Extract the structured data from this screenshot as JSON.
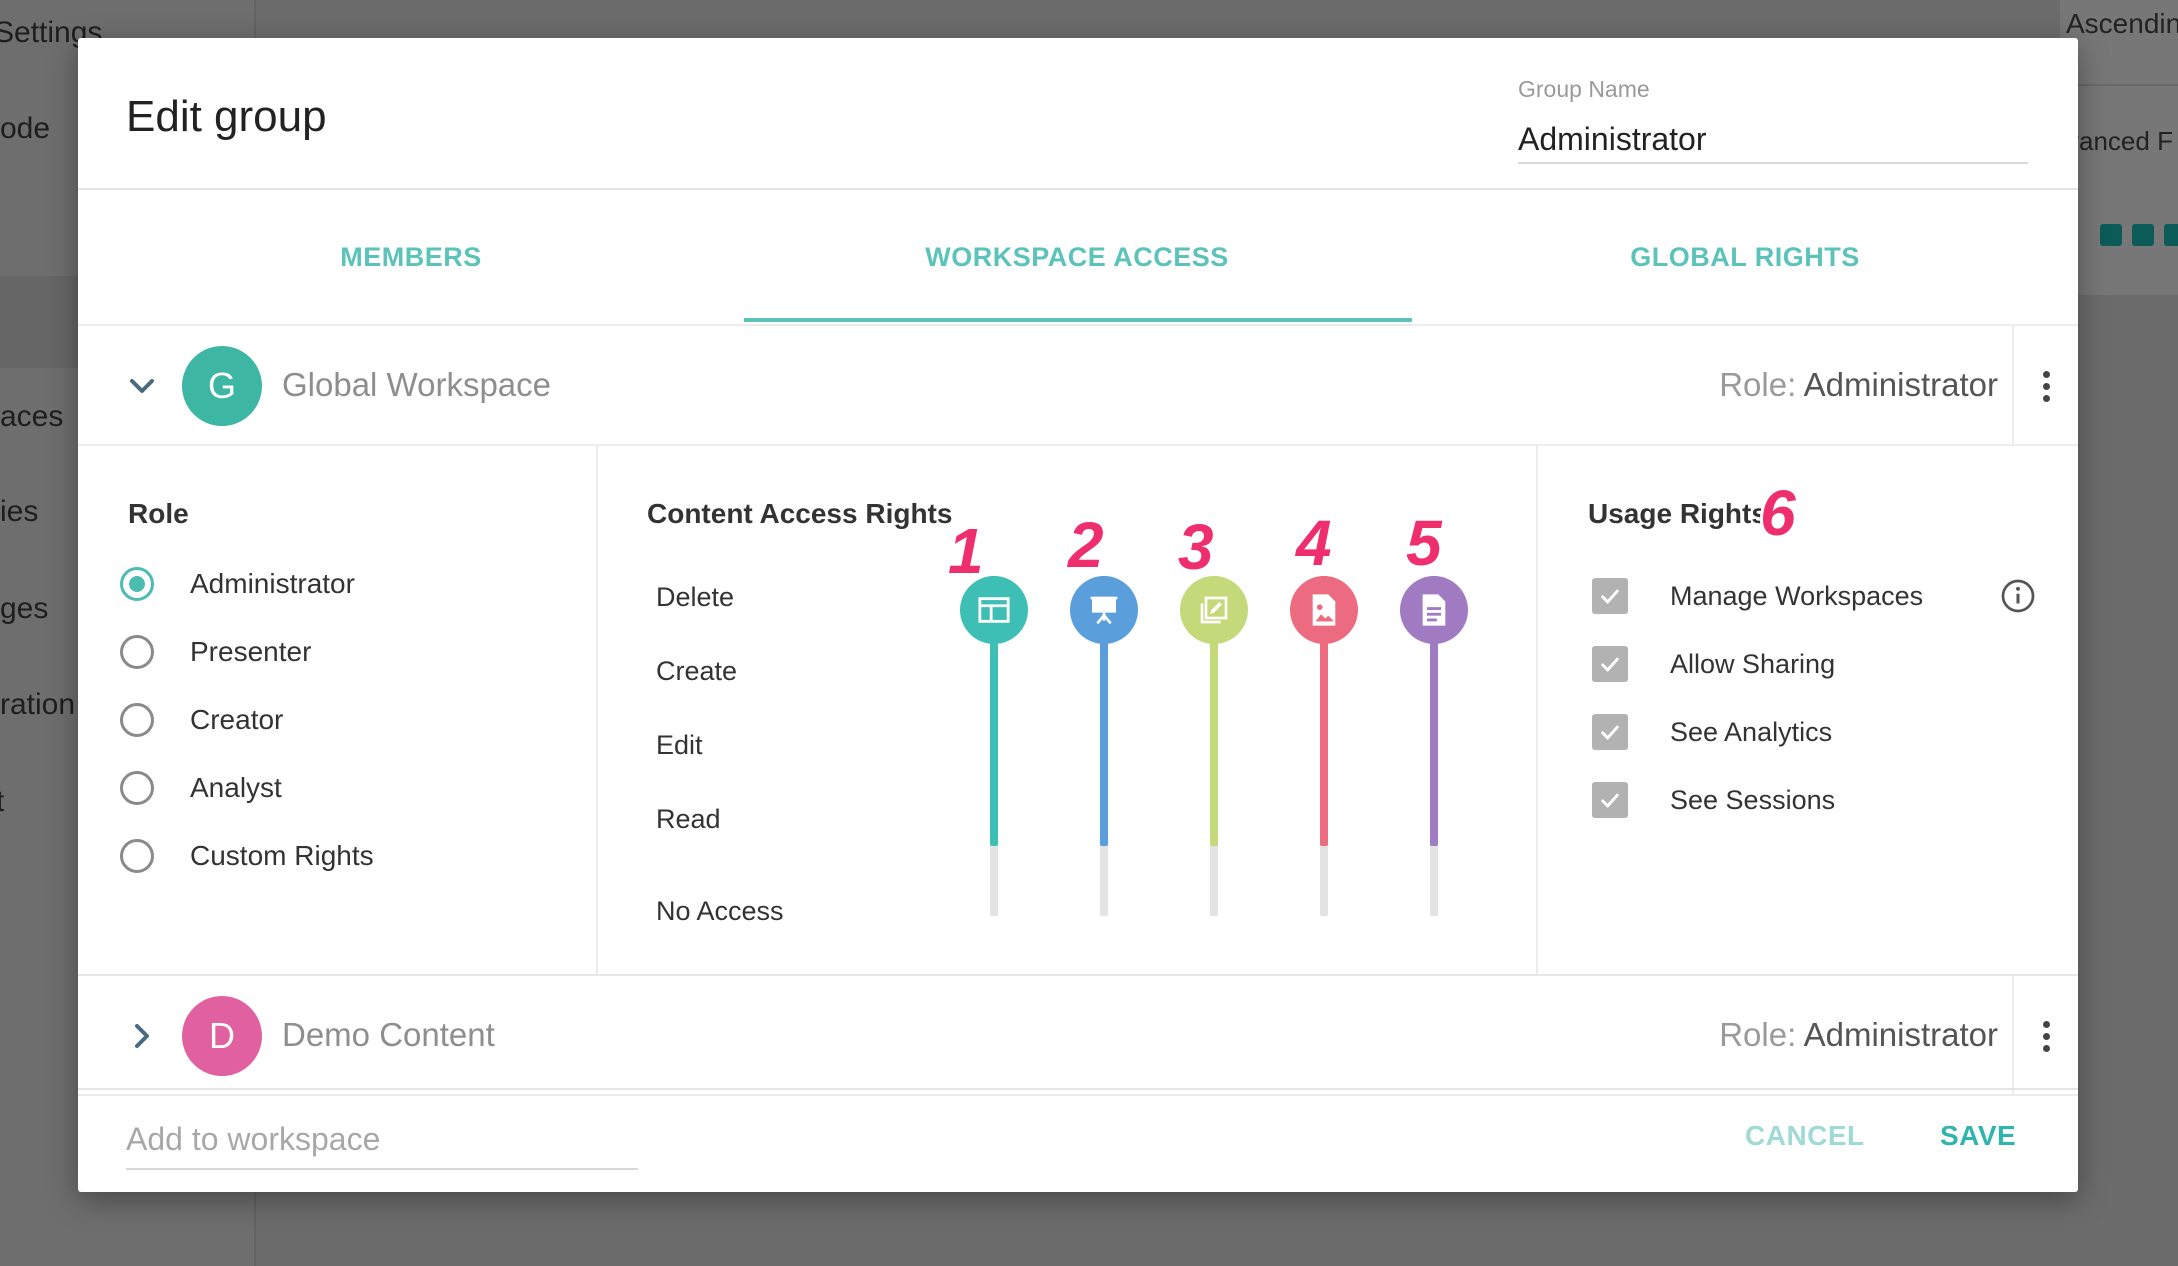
{
  "background": {
    "sidebar_items": [
      "Settings",
      "ode",
      "aces",
      "ies",
      "ges",
      "ration",
      "t"
    ],
    "right_header": "Ascendin",
    "right_subheader": "vanced F"
  },
  "dialog": {
    "title": "Edit group",
    "group_name_label": "Group Name",
    "group_name_value": "Administrator"
  },
  "tabs": [
    {
      "label": "MEMBERS",
      "active": false
    },
    {
      "label": "WORKSPACE ACCESS",
      "active": true
    },
    {
      "label": "GLOBAL RIGHTS",
      "active": false
    }
  ],
  "workspaces": [
    {
      "initial": "G",
      "name": "Global Workspace",
      "role_prefix": "Role:",
      "role": "Administrator",
      "color": "#3db6a4",
      "expanded": true
    },
    {
      "initial": "D",
      "name": "Demo Content",
      "role_prefix": "Role:",
      "role": "Administrator",
      "color": "#e1609f",
      "expanded": false
    }
  ],
  "role_section": {
    "title": "Role",
    "options": [
      "Administrator",
      "Presenter",
      "Creator",
      "Analyst",
      "Custom Rights"
    ],
    "selected": "Administrator"
  },
  "content_access": {
    "title": "Content Access Rights",
    "levels": [
      "Delete",
      "Create",
      "Edit",
      "Read",
      "No Access"
    ],
    "sliders": [
      {
        "number": "1",
        "icon": "dashboard-icon",
        "color": "#3dbfb5",
        "level": "Delete"
      },
      {
        "number": "2",
        "icon": "presentation-icon",
        "color": "#5a9fdc",
        "level": "Delete"
      },
      {
        "number": "3",
        "icon": "edit-chart-icon",
        "color": "#c3d97a",
        "level": "Delete"
      },
      {
        "number": "4",
        "icon": "image-file-icon",
        "color": "#ec6b81",
        "level": "Delete"
      },
      {
        "number": "5",
        "icon": "document-icon",
        "color": "#a07bc1",
        "level": "Delete"
      }
    ]
  },
  "usage_rights": {
    "title": "Usage Rights",
    "number": "6",
    "items": [
      {
        "label": "Manage Workspaces",
        "checked": true
      },
      {
        "label": "Allow Sharing",
        "checked": true
      },
      {
        "label": "See Analytics",
        "checked": true
      },
      {
        "label": "See Sessions",
        "checked": true
      }
    ]
  },
  "footer": {
    "add_placeholder": "Add to workspace",
    "cancel_label": "CANCEL",
    "save_label": "SAVE"
  }
}
